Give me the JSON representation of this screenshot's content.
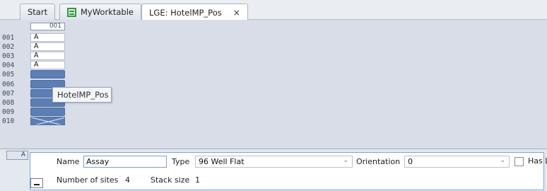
{
  "tabs": [
    {
      "label": "Start",
      "active": false
    },
    {
      "label": "MyWorktable",
      "active": false,
      "icon": "worktable-icon"
    },
    {
      "label": "LGE: HotelMP_Pos",
      "active": true,
      "close": "×"
    }
  ],
  "grid": {
    "column_header": "001",
    "rows": [
      {
        "label": "001",
        "value": "A",
        "state": "labeled"
      },
      {
        "label": "002",
        "value": "A",
        "state": "labeled"
      },
      {
        "label": "003",
        "value": "A",
        "state": "labeled"
      },
      {
        "label": "004",
        "value": "A",
        "state": "labeled"
      },
      {
        "label": "005",
        "value": "",
        "state": "occupied"
      },
      {
        "label": "006",
        "value": "",
        "state": "occupied"
      },
      {
        "label": "007",
        "value": "",
        "state": "occupied"
      },
      {
        "label": "008",
        "value": "",
        "state": "occupied"
      },
      {
        "label": "009",
        "value": "",
        "state": "occupied"
      },
      {
        "label": "010",
        "value": "",
        "state": "crossed"
      }
    ],
    "tooltip": "HotelMP_Pos",
    "occupied_color": "#5b7fb4"
  },
  "panel": {
    "side_tab": "A",
    "name_label": "Name",
    "name_value": "Assay",
    "type_label": "Type",
    "type_value": "96 Well Flat",
    "orientation_label": "Orientation",
    "orientation_value": "0",
    "has_lid_label": "Has Lid",
    "has_lid_checked": false,
    "sites_label": "Number of sites",
    "sites_value": "4",
    "stack_label": "Stack size",
    "stack_value": "1"
  }
}
